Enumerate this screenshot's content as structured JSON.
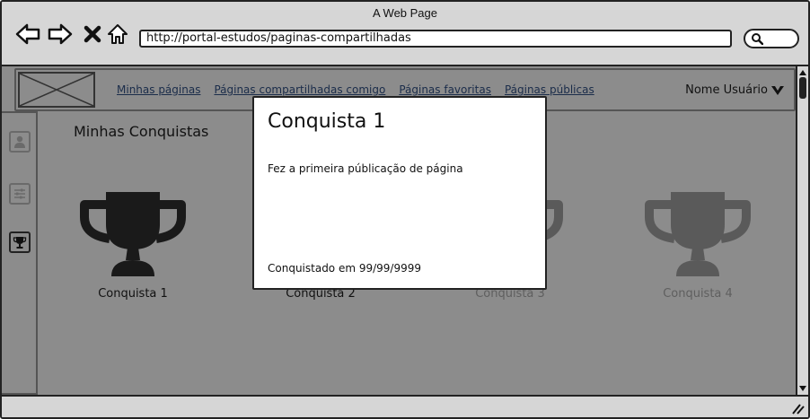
{
  "window": {
    "title": "A Web Page",
    "url": "http://portal-estudos/paginas-compartilhadas"
  },
  "nav": {
    "links": [
      "Minhas páginas",
      "Páginas compartilhadas comigo",
      "Páginas favoritas",
      "Páginas públicas"
    ],
    "user_name": "Nome Usuário"
  },
  "sidebar": {
    "items": [
      "user-icon",
      "settings-sliders-icon",
      "trophy-icon"
    ]
  },
  "content": {
    "title": "Minhas Conquistas",
    "achievements": [
      {
        "label": "Conquista 1",
        "color": "#1a1a1a"
      },
      {
        "label": "Conquista 2",
        "color": "#1a1a1a"
      },
      {
        "label": "Conquista 3",
        "color": "#5a5a5a"
      },
      {
        "label": "Conquista 4",
        "color": "#5a5a5a"
      }
    ]
  },
  "modal": {
    "title": "Conquista 1",
    "description": "Fez a primeira públicação de página",
    "date_text": "Conquistado em 99/99/9999"
  },
  "colors": {
    "overlay": "#8c8c8c",
    "chrome": "#d6d6d6",
    "modal_bg": "#ffffff"
  }
}
